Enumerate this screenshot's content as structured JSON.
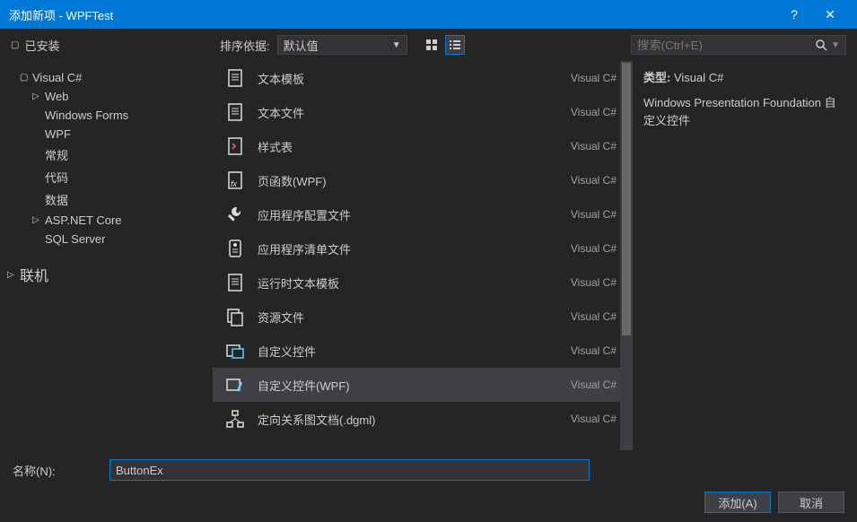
{
  "titlebar": {
    "title": "添加新项 - WPFTest",
    "help": "?",
    "close": "✕"
  },
  "header": {
    "installed": "已安装",
    "sort_label": "排序依据:",
    "sort_value": "默认值",
    "search_placeholder": "搜索(Ctrl+E)"
  },
  "sidebar": {
    "items": [
      {
        "label": "Visual C#",
        "level": 1,
        "expanded": true
      },
      {
        "label": "Web",
        "level": 2,
        "expandable": true
      },
      {
        "label": "Windows Forms",
        "level": 2
      },
      {
        "label": "WPF",
        "level": 2
      },
      {
        "label": "常规",
        "level": 2
      },
      {
        "label": "代码",
        "level": 2
      },
      {
        "label": "数据",
        "level": 2
      },
      {
        "label": "ASP.NET Core",
        "level": 2,
        "expandable": true
      },
      {
        "label": "SQL Server",
        "level": 2
      }
    ],
    "online": "联机"
  },
  "templates": [
    {
      "name": "文本模板",
      "lang": "Visual C#",
      "icon": "doc"
    },
    {
      "name": "文本文件",
      "lang": "Visual C#",
      "icon": "doc"
    },
    {
      "name": "样式表",
      "lang": "Visual C#",
      "icon": "style"
    },
    {
      "name": "页函数(WPF)",
      "lang": "Visual C#",
      "icon": "fx"
    },
    {
      "name": "应用程序配置文件",
      "lang": "Visual C#",
      "icon": "wrench"
    },
    {
      "name": "应用程序清单文件",
      "lang": "Visual C#",
      "icon": "manifest"
    },
    {
      "name": "运行时文本模板",
      "lang": "Visual C#",
      "icon": "doc"
    },
    {
      "name": "资源文件",
      "lang": "Visual C#",
      "icon": "copy"
    },
    {
      "name": "自定义控件",
      "lang": "Visual C#",
      "icon": "custom"
    },
    {
      "name": "自定义控件(WPF)",
      "lang": "Visual C#",
      "icon": "customwpf",
      "selected": true
    },
    {
      "name": "定向关系图文档(.dgml)",
      "lang": "Visual C#",
      "icon": "graph"
    }
  ],
  "preview": {
    "type_label": "类型:",
    "type_value": "Visual C#",
    "description": "Windows Presentation Foundation 自定义控件"
  },
  "bottom": {
    "name_label": "名称(N):",
    "name_value": "ButtonEx",
    "add": "添加(A)",
    "cancel": "取消"
  }
}
